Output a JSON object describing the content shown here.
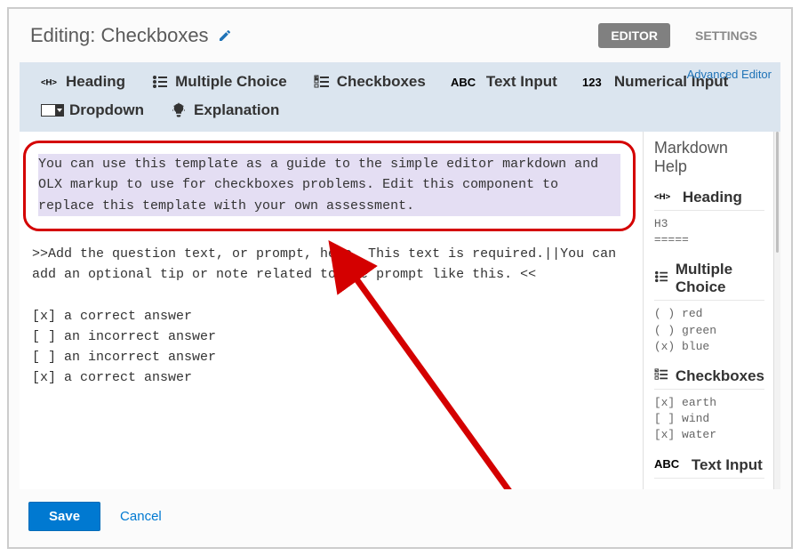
{
  "header": {
    "title": "Editing: Checkboxes",
    "tabs": {
      "editor": "EDITOR",
      "settings": "SETTINGS"
    }
  },
  "toolbar": {
    "heading": "Heading",
    "multiple_choice": "Multiple Choice",
    "checkboxes": "Checkboxes",
    "text_input": "Text Input",
    "numerical_input": "Numerical Input",
    "dropdown": "Dropdown",
    "explanation": "Explanation",
    "advanced_editor": "Advanced Editor"
  },
  "editor": {
    "intro": "You can use this template as a guide to the simple editor markdown and OLX markup to use for checkboxes problems. Edit this component to replace this template with your own assessment.",
    "body": ">>Add the question text, or prompt, here. This text is required.||You can add an optional tip or note related to the prompt like this. <<\n\n[x] a correct answer\n[ ] an incorrect answer\n[ ] an incorrect answer\n[x] a correct answer"
  },
  "help": {
    "title": "Markdown Help",
    "heading_label": "Heading",
    "heading_example": "H3\n=====",
    "mc_label": "Multiple Choice",
    "mc_example": "( ) red\n( ) green\n(x) blue",
    "cb_label": "Checkboxes",
    "cb_example": "[x] earth\n[ ] wind\n[x] water",
    "ti_label": "Text Input"
  },
  "footer": {
    "save": "Save",
    "cancel": "Cancel"
  }
}
